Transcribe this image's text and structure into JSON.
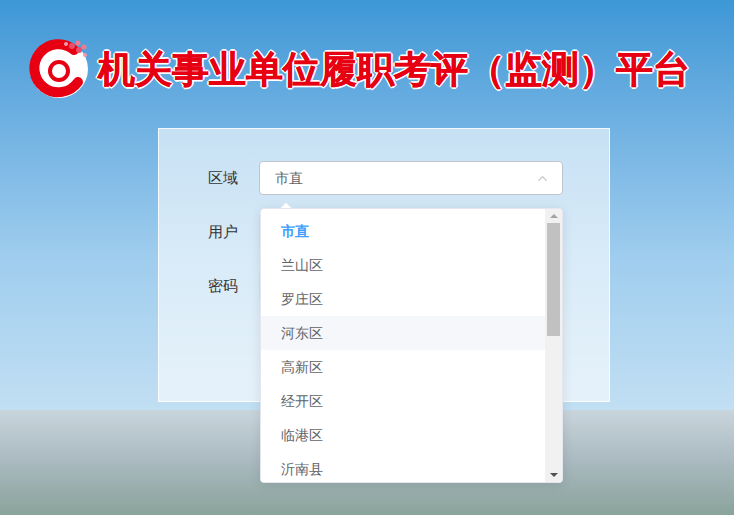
{
  "header": {
    "title": "机关事业单位履职考评（监测）平台"
  },
  "form": {
    "fields": [
      {
        "label": "区域",
        "kind": "select",
        "value": "市直",
        "expanded": true
      },
      {
        "label": "用户",
        "kind": "input",
        "value": ""
      },
      {
        "label": "密码",
        "kind": "password",
        "value": ""
      }
    ]
  },
  "dropdown": {
    "open": true,
    "options": [
      {
        "label": "市直",
        "selected": true,
        "hovered": false
      },
      {
        "label": "兰山区",
        "selected": false,
        "hovered": false
      },
      {
        "label": "罗庄区",
        "selected": false,
        "hovered": false
      },
      {
        "label": "河东区",
        "selected": false,
        "hovered": true
      },
      {
        "label": "高新区",
        "selected": false,
        "hovered": false
      },
      {
        "label": "经开区",
        "selected": false,
        "hovered": false
      },
      {
        "label": "临港区",
        "selected": false,
        "hovered": false
      },
      {
        "label": "沂南县",
        "selected": false,
        "hovered": false
      }
    ],
    "scrollbar": {
      "level": 0.46,
      "position": 0
    }
  }
}
